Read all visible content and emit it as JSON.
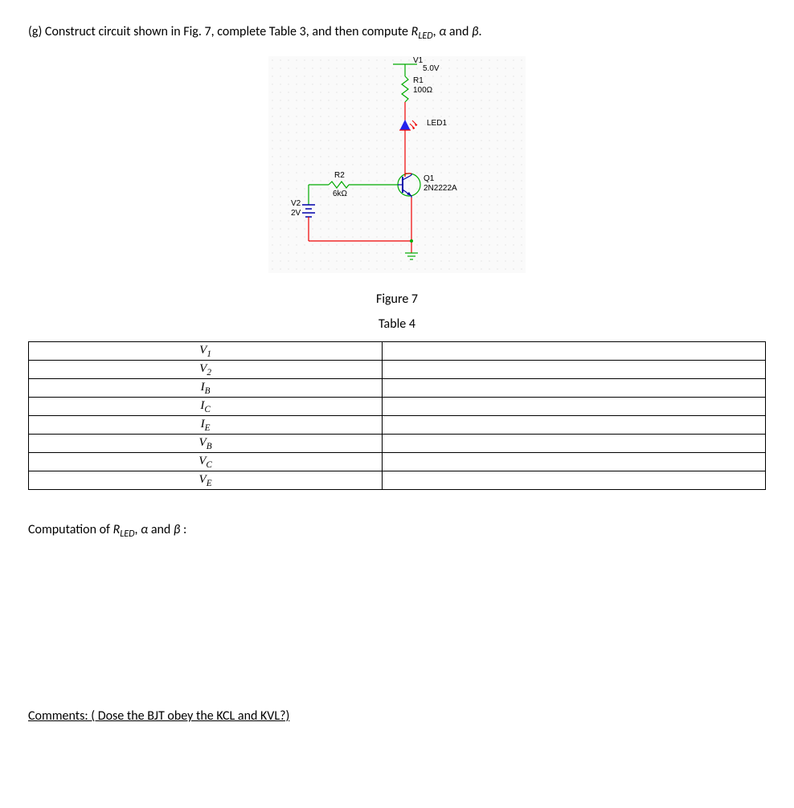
{
  "prompt_prefix": "(g) Construct circuit shown in Fig. 7, complete Table 3, and then compute ",
  "prompt_r": "R",
  "prompt_r_sub": "LED",
  "prompt_mid1": ", ",
  "prompt_alpha": "α",
  "prompt_mid2": " and ",
  "prompt_beta": "β",
  "prompt_end": ".",
  "schematic": {
    "v1_name": "V1",
    "v1_val": "5.0V",
    "r1_name": "R1",
    "r1_val": "100Ω",
    "led_name": "LED1",
    "q1_name": "Q1",
    "q1_val": "2N2222A",
    "r2_name": "R2",
    "r2_val": "6kΩ",
    "v2_name": "V2",
    "v2_val": "2V"
  },
  "caption_fig": "Figure 7",
  "caption_tab": "Table 4",
  "rows": [
    {
      "sym": "V",
      "sub": "1"
    },
    {
      "sym": "V",
      "sub": "2"
    },
    {
      "sym": "I",
      "sub": "B"
    },
    {
      "sym": "I",
      "sub": "C"
    },
    {
      "sym": "I",
      "sub": "E"
    },
    {
      "sym": "V",
      "sub": "B"
    },
    {
      "sym": "V",
      "sub": "C"
    },
    {
      "sym": "V",
      "sub": "E"
    }
  ],
  "computation_prefix": "Computation of ",
  "computation_r": "R",
  "computation_r_sub": "LED",
  "computation_mid1": ", ",
  "computation_alpha": "α",
  "computation_mid2": " and ",
  "computation_beta": "β",
  "computation_end": " :",
  "comments": "Comments: ( Dose the BJT obey the KCL and KVL?)"
}
